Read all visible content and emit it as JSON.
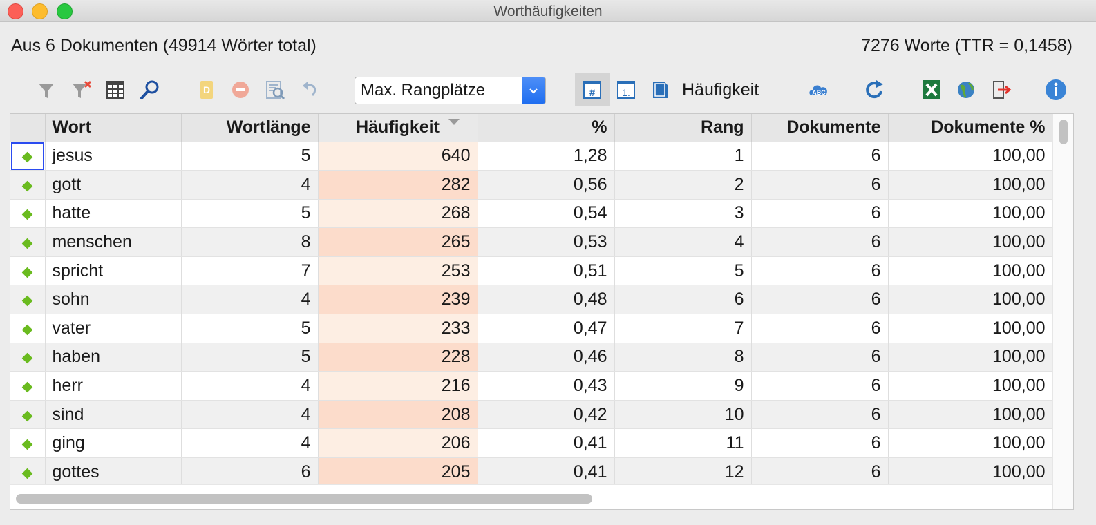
{
  "window": {
    "title": "Worthäufigkeiten"
  },
  "info": {
    "left": "Aus 6 Dokumenten (49914 Wörter total)",
    "right": "7276 Worte (TTR = 0,1458)"
  },
  "toolbar": {
    "combo_value": "Max. Rangplätze",
    "sort_label": "Häufigkeit",
    "icons": [
      "filter-icon",
      "clear-filter-icon",
      "columns-icon",
      "search-icon",
      "dictionary-icon",
      "remove-icon",
      "zoom-document-icon",
      "undo-icon",
      "hash-icon",
      "rank-icon",
      "document-icon",
      "word-cloud-icon",
      "refresh-icon",
      "excel-export-icon",
      "web-export-icon",
      "exit-icon",
      "info-icon"
    ]
  },
  "table": {
    "columns": [
      "Wort",
      "Wortlänge",
      "Häufigkeit",
      "%",
      "Rang",
      "Dokumente",
      "Dokumente %"
    ],
    "sorted_column": "Häufigkeit",
    "rows": [
      [
        "jesus",
        "5",
        "640",
        "1,28",
        "1",
        "6",
        "100,00"
      ],
      [
        "gott",
        "4",
        "282",
        "0,56",
        "2",
        "6",
        "100,00"
      ],
      [
        "hatte",
        "5",
        "268",
        "0,54",
        "3",
        "6",
        "100,00"
      ],
      [
        "menschen",
        "8",
        "265",
        "0,53",
        "4",
        "6",
        "100,00"
      ],
      [
        "spricht",
        "7",
        "253",
        "0,51",
        "5",
        "6",
        "100,00"
      ],
      [
        "sohn",
        "4",
        "239",
        "0,48",
        "6",
        "6",
        "100,00"
      ],
      [
        "vater",
        "5",
        "233",
        "0,47",
        "7",
        "6",
        "100,00"
      ],
      [
        "haben",
        "5",
        "228",
        "0,46",
        "8",
        "6",
        "100,00"
      ],
      [
        "herr",
        "4",
        "216",
        "0,43",
        "9",
        "6",
        "100,00"
      ],
      [
        "sind",
        "4",
        "208",
        "0,42",
        "10",
        "6",
        "100,00"
      ],
      [
        "ging",
        "4",
        "206",
        "0,41",
        "11",
        "6",
        "100,00"
      ],
      [
        "gottes",
        "6",
        "205",
        "0,41",
        "12",
        "6",
        "100,00"
      ]
    ]
  },
  "colors": {
    "accent": "#1f6ef0",
    "marker": "#6abb1f",
    "freq_light": "#fdeee3",
    "freq_dark": "#fcdccb"
  }
}
